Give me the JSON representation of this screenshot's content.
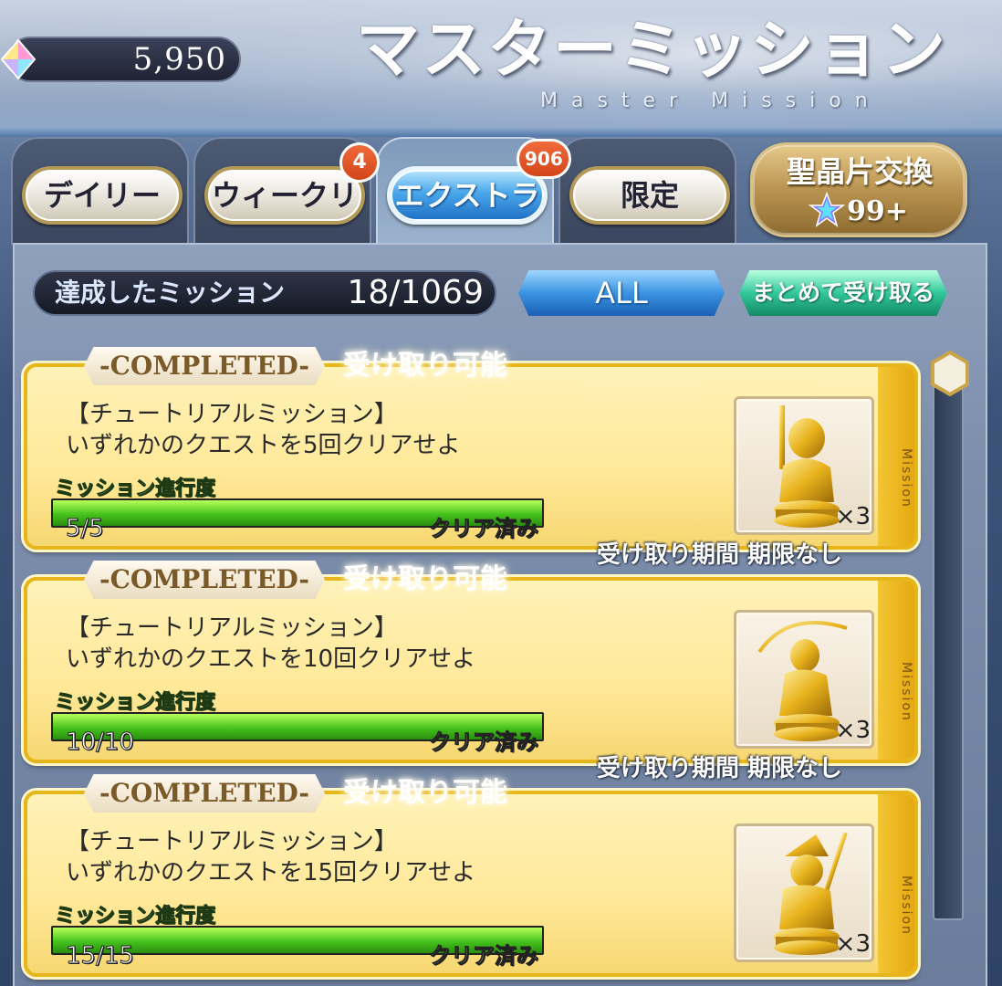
{
  "header": {
    "currency_value": "5,950",
    "currency_icon": "saint-quartz-icon",
    "title_jp": "マスターミッション",
    "title_en": "Master Mission"
  },
  "tabs": [
    {
      "label": "デイリー",
      "active": false,
      "badge": ""
    },
    {
      "label": "ウィークリー",
      "active": false,
      "badge": "4"
    },
    {
      "label": "エクストラ",
      "active": true,
      "badge": "906"
    },
    {
      "label": "限定",
      "active": false,
      "badge": ""
    }
  ],
  "exchange": {
    "label": "聖晶片交換",
    "count": "99+",
    "icon": "saint-quartz-fragment-icon"
  },
  "status": {
    "label": "達成したミッション",
    "value": "18/1069"
  },
  "filter": {
    "label": "ALL"
  },
  "collect_all": {
    "label": "まとめて受け取る"
  },
  "missions": [
    {
      "completed_label": "-COMPLETED-",
      "claimable_label": "受け取り可能",
      "category": "【チュートリアルミッション】",
      "description": "いずれかのクエストを5回クリアせよ",
      "progress_label": "ミッション進行度",
      "progress_value": "5/5",
      "progress_fraction": 1.0,
      "progress_status": "クリア済み",
      "reward_icon": "gold-saber-statue-icon",
      "reward_qty": "×3",
      "tag": "Mission",
      "period": "受け取り期間 期限なし"
    },
    {
      "completed_label": "-COMPLETED-",
      "claimable_label": "受け取り可能",
      "category": "【チュートリアルミッション】",
      "description": "いずれかのクエストを10回クリアせよ",
      "progress_label": "ミッション進行度",
      "progress_value": "10/10",
      "progress_fraction": 1.0,
      "progress_status": "クリア済み",
      "reward_icon": "gold-archer-statue-icon",
      "reward_qty": "×3",
      "tag": "Mission",
      "period": "受け取り期間 期限なし"
    },
    {
      "completed_label": "-COMPLETED-",
      "claimable_label": "受け取り可能",
      "category": "【チュートリアルミッション】",
      "description": "いずれかのクエストを15回クリアせよ",
      "progress_label": "ミッション進行度",
      "progress_value": "15/15",
      "progress_fraction": 1.0,
      "progress_status": "クリア済み",
      "reward_icon": "gold-lancer-statue-icon",
      "reward_qty": "×3",
      "tag": "Mission",
      "period": "受け取り期間 期限なし"
    }
  ]
}
